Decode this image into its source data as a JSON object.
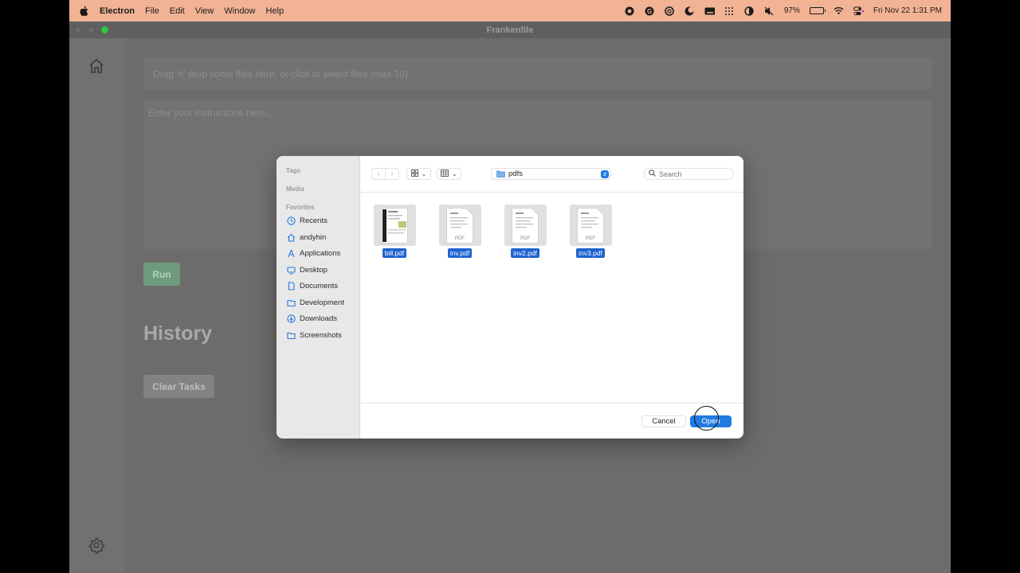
{
  "menubar": {
    "app_name": "Electron",
    "menus": [
      "File",
      "Edit",
      "View",
      "Window",
      "Help"
    ],
    "battery_percent": "97%",
    "battery_level": 0.97,
    "datetime": "Fri Nov 22  1:31 PM"
  },
  "window": {
    "title": "Frankenfile"
  },
  "main": {
    "dropzone_text": "Drag 'n' drop some files here, or click to select files (max 10)",
    "instructions_placeholder": "Enter your instructions here...",
    "run_label": "Run",
    "history_title": "History",
    "clear_tasks_label": "Clear Tasks"
  },
  "dialog": {
    "sections": {
      "tags": "Tags",
      "media": "Media",
      "favorites": "Favorites"
    },
    "favorites": [
      {
        "label": "Recents",
        "icon": "clock-icon"
      },
      {
        "label": "andyhin",
        "icon": "home-icon"
      },
      {
        "label": "Applications",
        "icon": "applications-icon"
      },
      {
        "label": "Desktop",
        "icon": "desktop-icon"
      },
      {
        "label": "Documents",
        "icon": "document-icon"
      },
      {
        "label": "Development",
        "icon": "folder-icon"
      },
      {
        "label": "Downloads",
        "icon": "download-icon"
      },
      {
        "label": "Screenshots",
        "icon": "folder-icon"
      }
    ],
    "current_folder": "pdfs",
    "search_placeholder": "Search",
    "pdf_label": "PDF",
    "files": [
      {
        "name": "bill.pdf",
        "selected": true
      },
      {
        "name": "inv.pdf",
        "selected": true
      },
      {
        "name": "inv2.pdf",
        "selected": true
      },
      {
        "name": "inv3.pdf",
        "selected": true
      }
    ],
    "cancel_label": "Cancel",
    "open_label": "Open"
  },
  "colors": {
    "menubar_bg": "#f2b294",
    "accent_blue": "#1f7be0",
    "selection_blue": "#1f63d0",
    "run_green": "#6d9b7c"
  }
}
